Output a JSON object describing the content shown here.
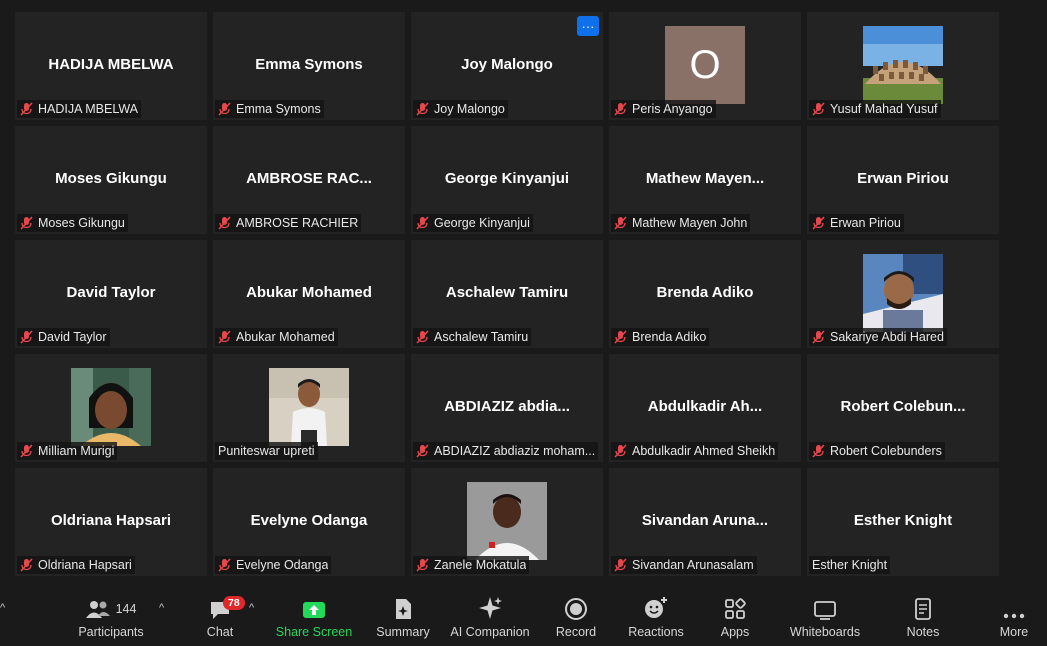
{
  "participants": [
    {
      "display": "HADIJA MBELWA",
      "label": "HADIJA MBELWA",
      "muted": true
    },
    {
      "display": "Emma Symons",
      "label": "Emma Symons",
      "muted": true
    },
    {
      "display": "Joy Malongo",
      "label": "Joy Malongo",
      "muted": true,
      "more": "···"
    },
    {
      "display": "",
      "label": "Peris Anyango",
      "muted": true,
      "avatar_letter": "O",
      "avatar_color": "#8a7168"
    },
    {
      "display": "",
      "label": "Yusuf Mahad Yusuf",
      "muted": true
    },
    {
      "display": "Moses Gikungu",
      "label": "Moses Gikungu",
      "muted": true
    },
    {
      "display": "AMBROSE  RAC...",
      "label": "AMBROSE RACHIER",
      "muted": true
    },
    {
      "display": "George Kinyanjui",
      "label": "George Kinyanjui",
      "muted": true
    },
    {
      "display": "Mathew  Mayen...",
      "label": "Mathew Mayen John",
      "muted": true
    },
    {
      "display": "Erwan Piriou",
      "label": "Erwan Piriou",
      "muted": true
    },
    {
      "display": "David Taylor",
      "label": "David Taylor",
      "muted": true
    },
    {
      "display": "Abukar Mohamed",
      "label": "Abukar Mohamed",
      "muted": true
    },
    {
      "display": "Aschalew Tamiru",
      "label": "Aschalew Tamiru",
      "muted": true
    },
    {
      "display": "Brenda Adiko",
      "label": "Brenda Adiko",
      "muted": true
    },
    {
      "display": "",
      "label": "Sakariye Abdi Hared",
      "muted": true
    },
    {
      "display": "",
      "label": "Milliam Murigi",
      "muted": true
    },
    {
      "display": "",
      "label": "Puniteswar upreti",
      "muted": false
    },
    {
      "display": "ABDIAZIZ  abdia...",
      "label": "ABDIAZIZ abdiaziz moham...",
      "muted": true
    },
    {
      "display": "Abdulkadir  Ah...",
      "label": "Abdulkadir Ahmed Sheikh",
      "muted": true
    },
    {
      "display": "Robert  Colebun...",
      "label": "Robert Colebunders",
      "muted": true
    },
    {
      "display": "Oldriana Hapsari",
      "label": "Oldriana Hapsari",
      "muted": true
    },
    {
      "display": "Evelyne Odanga",
      "label": "Evelyne Odanga",
      "muted": true
    },
    {
      "display": "",
      "label": "Zanele Mokatula",
      "muted": true
    },
    {
      "display": "Sivandan  Aruna...",
      "label": "Sivandan Arunasalam",
      "muted": true
    },
    {
      "display": "Esther Knight",
      "label": "Esther Knight",
      "muted": false
    }
  ],
  "toolbar": {
    "participants": {
      "label": "Participants",
      "count": "144"
    },
    "chat": {
      "label": "Chat",
      "badge": "78"
    },
    "share": {
      "label": "Share Screen"
    },
    "summary": {
      "label": "Summary"
    },
    "ai": {
      "label": "AI Companion"
    },
    "record": {
      "label": "Record"
    },
    "reactions": {
      "label": "Reactions"
    },
    "apps": {
      "label": "Apps"
    },
    "whiteboards": {
      "label": "Whiteboards"
    },
    "notes": {
      "label": "Notes"
    },
    "more": {
      "label": "More"
    }
  },
  "colors": {
    "share_green": "#23d959",
    "badge_red": "#e02828",
    "mute_red": "#e5484d",
    "more_blue": "#0e71eb"
  }
}
